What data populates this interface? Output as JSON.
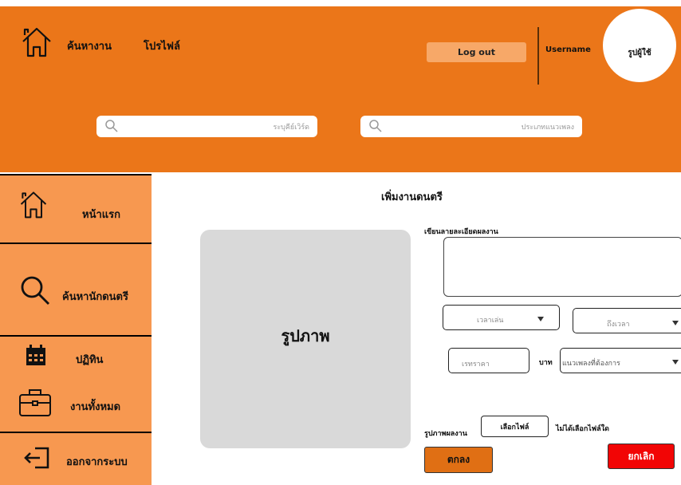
{
  "header": {
    "nav": [
      "ค้นหางาน",
      "โปรไฟล์"
    ],
    "logout_label": "Log out",
    "username": "Username",
    "avatar_label": "รูปผู้ใช้",
    "search_musician_placeholder": "ระบุคีย์เวิร์ด",
    "search_genre_placeholder": "ประเภทแนวเพลง",
    "accent_color": "#EB7619"
  },
  "sidebar": {
    "items": [
      {
        "label": "หน้าแรก",
        "icon": "home-icon"
      },
      {
        "label": "ค้นหานักดนตรี",
        "icon": "search-icon"
      },
      {
        "label": "ปฏิทิน",
        "icon": "calendar-icon"
      },
      {
        "label": "งานทั้งหมด",
        "icon": "briefcase-icon"
      },
      {
        "label": "ออกจากระบบ",
        "icon": "logout-icon"
      }
    ],
    "color": "#F79850"
  },
  "main": {
    "title": "เพิ่มงานดนตรี",
    "image_placeholder": "รูปภาพ",
    "description_label": "เขียนลายละเอียดผลงาน",
    "start_time_placeholder": "เวลาเล่น",
    "end_time_placeholder": "ถึงเวลา",
    "price_placeholder": "เรทราคา",
    "currency_label": "บาท",
    "genre_placeholder": "แนวเพลงที่ต้องการ",
    "work_image_label": "รูปภาพผลงาน",
    "choose_file_label": "เลือกไฟล์",
    "no_file_label": "ไม่ได้เลือกไฟล์ใด",
    "ok_label": "ตกลง",
    "cancel_label": "ยกเลิก"
  }
}
